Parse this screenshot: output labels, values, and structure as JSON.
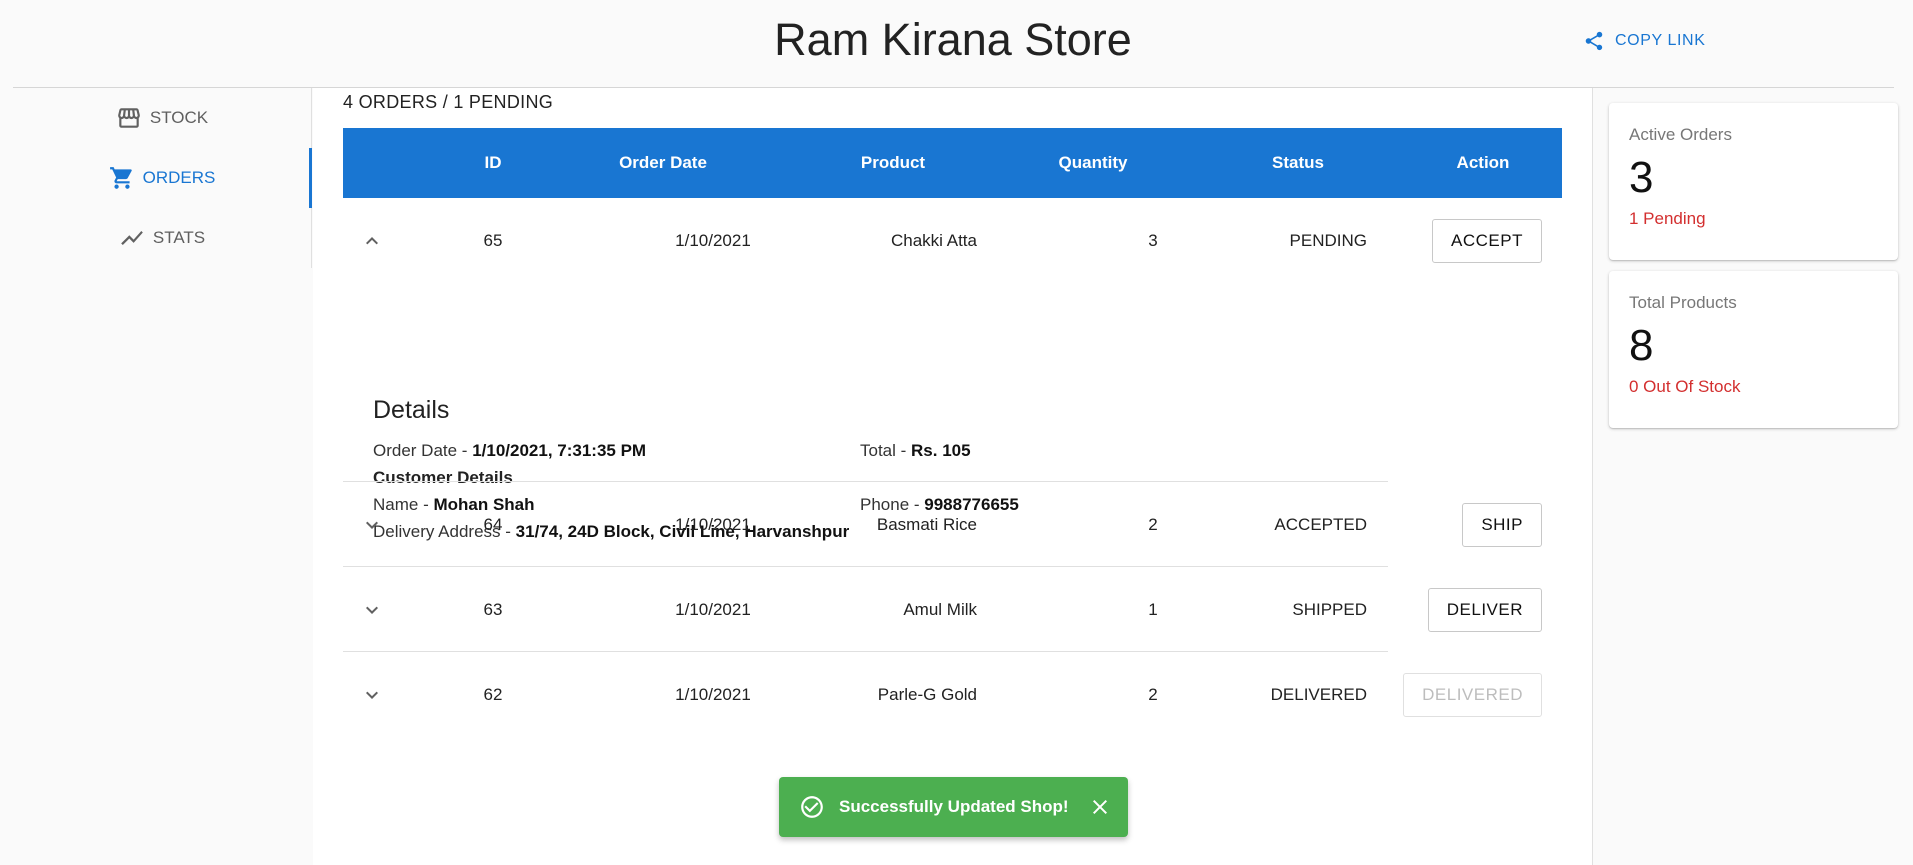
{
  "header": {
    "title": "Ram Kirana Store",
    "copy_link_label": "COPY LINK"
  },
  "sidebar": {
    "items": [
      {
        "label": "STOCK",
        "icon": "store-icon",
        "active": false
      },
      {
        "label": "ORDERS",
        "icon": "shopping-cart-icon",
        "active": true
      },
      {
        "label": "STATS",
        "icon": "trending-up-icon",
        "active": false
      }
    ]
  },
  "orders": {
    "summary": "4 ORDERS / 1 PENDING",
    "columns": [
      "ID",
      "Order Date",
      "Product",
      "Quantity",
      "Status",
      "Action"
    ],
    "rows": [
      {
        "id": "65",
        "date": "1/10/2021",
        "product": "Chakki Atta",
        "quantity": "3",
        "status": "PENDING",
        "action": "ACCEPT",
        "expanded": true,
        "action_disabled": false
      },
      {
        "id": "64",
        "date": "1/10/2021",
        "product": "Basmati Rice",
        "quantity": "2",
        "status": "ACCEPTED",
        "action": "SHIP",
        "expanded": false,
        "action_disabled": false
      },
      {
        "id": "63",
        "date": "1/10/2021",
        "product": "Amul Milk",
        "quantity": "1",
        "status": "SHIPPED",
        "action": "DELIVER",
        "expanded": false,
        "action_disabled": false
      },
      {
        "id": "62",
        "date": "1/10/2021",
        "product": "Parle-G Gold",
        "quantity": "2",
        "status": "DELIVERED",
        "action": "DELIVERED",
        "expanded": false,
        "action_disabled": true
      }
    ],
    "details": {
      "heading": "Details",
      "order_date_label": "Order Date - ",
      "order_date_value": "1/10/2021, 7:31:35 PM",
      "total_label": "Total - ",
      "total_value": "Rs. 105",
      "customer_heading": "Customer Details",
      "name_label": "Name - ",
      "name_value": "Mohan Shah",
      "phone_label": "Phone - ",
      "phone_value": "9988776655",
      "address_label": "Delivery Address - ",
      "address_value": "31/74, 24D Block, Civil Line, Harvanshpur"
    }
  },
  "stats": [
    {
      "label": "Active Orders",
      "value": "3",
      "sub": "1 Pending"
    },
    {
      "label": "Total Products",
      "value": "8",
      "sub": "0 Out Of Stock"
    }
  ],
  "toast": {
    "message": "Successfully Updated Shop!",
    "icon": "check-circle-icon"
  },
  "colors": {
    "primary": "#1976d2",
    "success": "#4caf50",
    "error": "#d32f2f"
  }
}
